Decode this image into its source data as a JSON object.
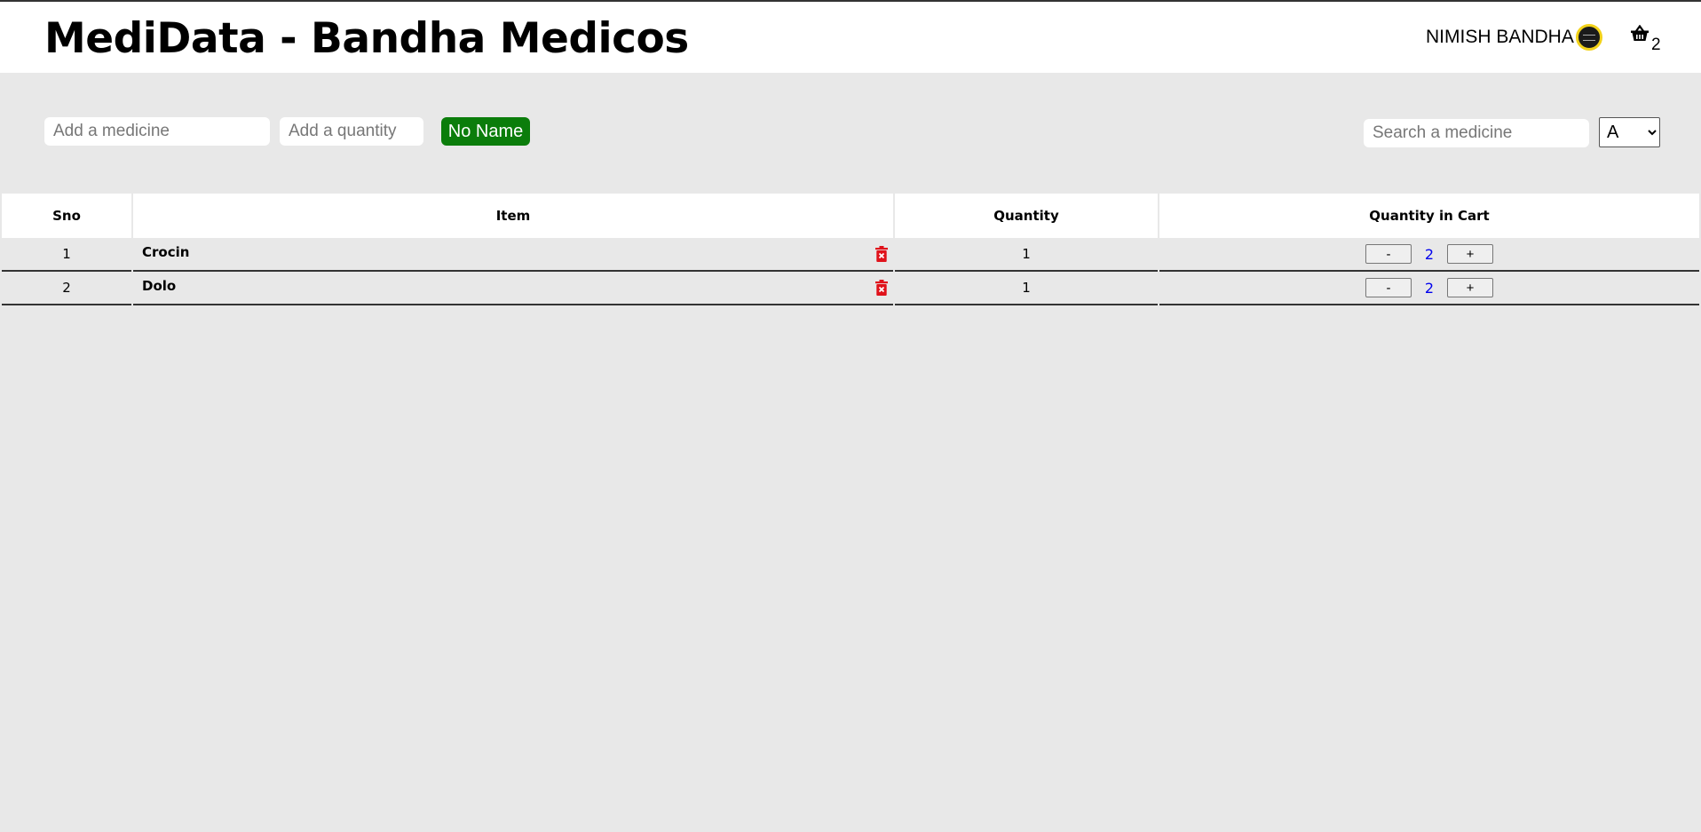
{
  "header": {
    "title": "MediData - Bandha Medicos",
    "user_name": "NIMISH BANDHA",
    "cart_count": "2"
  },
  "toolbar": {
    "medicine_placeholder": "Add a medicine",
    "quantity_placeholder": "Add a quantity",
    "add_button_label": "No Name",
    "search_placeholder": "Search a medicine",
    "sort_selected": "A"
  },
  "table": {
    "headers": [
      "Sno",
      "Item",
      "Quantity",
      "Quantity in Cart"
    ],
    "rows": [
      {
        "sno": "1",
        "item": "Crocin",
        "quantity": "1",
        "in_cart": "2",
        "minus": "-",
        "plus": "+"
      },
      {
        "sno": "2",
        "item": "Dolo",
        "quantity": "1",
        "in_cart": "2",
        "minus": "-",
        "plus": "+"
      }
    ]
  },
  "colors": {
    "add_button": "#0b7d0b",
    "delete_icon": "#e0121b",
    "cart_value": "#0000ee",
    "avatar_ring": "#f2d21a"
  },
  "icons": [
    "basket-icon",
    "trash-icon",
    "chevron-down-icon"
  ]
}
